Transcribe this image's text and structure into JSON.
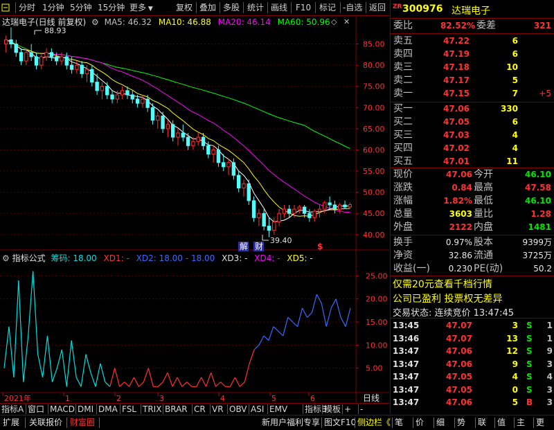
{
  "toolbar": {
    "left_items": [
      "分时",
      "1分钟",
      "5分钟",
      "15分钟",
      "更多"
    ],
    "right_items": [
      "复权",
      "叠加",
      "多股",
      "统计",
      "画线",
      "F10",
      "标记",
      "-自选",
      "返回"
    ]
  },
  "stock": {
    "name": "达瑞电子",
    "code": "300976",
    "market_tag": "ZR"
  },
  "main_chart": {
    "title": "达瑞电子(日线 前复权)",
    "ma": [
      {
        "label": "MA5: 46.32",
        "color": "#ffffff"
      },
      {
        "label": "MA10: 46.88",
        "color": "#ffff00"
      },
      {
        "label": "MA20: 46.14",
        "color": "#ff00ff"
      },
      {
        "label": "MA60: 50.96",
        "color": "#00ff00"
      }
    ],
    "high_label": "88.93",
    "low_label": "39.40",
    "marker_jie": "解",
    "marker_cai": "财",
    "marker_s": "$",
    "y_ticks": [
      "85.00",
      "80.00",
      "75.00",
      "70.00",
      "65.00",
      "60.00",
      "55.00",
      "50.00",
      "45.00",
      "40.00"
    ],
    "ma5_color": "#ffffff",
    "ma10_color": "#ffff00",
    "ma20_color": "#ff00ff",
    "ma60_color": "#00ff00",
    "up_color": "#ff3232",
    "down_color": "#54fcfc"
  },
  "chart_data": {
    "type": "candlestick",
    "y_range": [
      38,
      90
    ],
    "candles": [
      [
        85,
        87,
        83,
        86
      ],
      [
        86,
        88.93,
        84,
        85
      ],
      [
        85,
        86,
        82,
        83
      ],
      [
        83,
        84,
        80,
        81
      ],
      [
        81,
        84,
        80,
        83
      ],
      [
        83,
        85,
        81,
        82
      ],
      [
        82,
        83,
        79,
        80
      ],
      [
        80,
        83,
        79,
        82
      ],
      [
        82,
        84,
        81,
        83
      ],
      [
        83,
        84,
        81,
        82
      ],
      [
        82,
        83,
        80,
        81
      ],
      [
        81,
        83,
        80,
        82
      ],
      [
        82,
        83,
        79,
        80
      ],
      [
        80,
        82,
        78,
        79
      ],
      [
        79,
        81,
        78,
        80
      ],
      [
        80,
        81,
        77,
        78
      ],
      [
        78,
        80,
        76,
        79
      ],
      [
        79,
        80,
        75,
        76
      ],
      [
        76,
        78,
        73,
        74
      ],
      [
        74,
        76,
        72,
        75
      ],
      [
        75,
        76,
        72,
        73
      ],
      [
        73,
        74,
        71,
        72
      ],
      [
        72,
        74,
        71,
        73
      ],
      [
        73,
        75,
        72,
        74
      ],
      [
        74,
        75,
        72,
        73
      ],
      [
        73,
        74,
        71,
        72
      ],
      [
        72,
        73,
        70,
        71
      ],
      [
        71,
        73,
        70,
        72
      ],
      [
        72,
        73,
        69,
        70
      ],
      [
        70,
        71,
        66,
        67
      ],
      [
        67,
        69,
        65,
        68
      ],
      [
        68,
        69,
        64,
        65
      ],
      [
        65,
        67,
        63,
        66
      ],
      [
        66,
        67,
        62,
        63
      ],
      [
        63,
        65,
        61,
        64
      ],
      [
        64,
        66,
        62,
        63
      ],
      [
        63,
        64,
        60,
        61
      ],
      [
        61,
        63,
        60,
        62
      ],
      [
        62,
        64,
        61,
        63
      ],
      [
        63,
        64,
        60,
        61
      ],
      [
        61,
        62,
        58,
        59
      ],
      [
        59,
        61,
        57,
        60
      ],
      [
        60,
        61,
        56,
        57
      ],
      [
        57,
        59,
        55,
        56
      ],
      [
        56,
        58,
        54,
        57
      ],
      [
        57,
        58,
        53,
        54
      ],
      [
        54,
        55,
        50,
        51
      ],
      [
        51,
        53,
        49,
        52
      ],
      [
        52,
        53,
        47,
        48
      ],
      [
        48,
        49,
        43,
        44
      ],
      [
        44,
        46,
        42,
        45
      ],
      [
        45,
        46,
        41,
        42
      ],
      [
        42,
        44,
        39.4,
        41
      ],
      [
        41,
        44,
        40,
        43
      ],
      [
        43,
        46,
        42,
        45
      ],
      [
        45,
        47,
        44,
        46
      ],
      [
        46,
        47,
        44,
        45
      ],
      [
        45,
        47,
        44,
        46
      ],
      [
        46,
        47,
        45,
        46.5
      ],
      [
        46.5,
        47,
        44,
        45
      ],
      [
        45,
        46,
        43,
        44
      ],
      [
        44,
        46,
        43,
        45.5
      ],
      [
        45.5,
        47,
        44,
        46
      ],
      [
        46,
        48,
        45,
        47.5
      ],
      [
        47.5,
        49,
        46,
        47
      ],
      [
        47,
        48,
        45,
        46
      ],
      [
        46,
        47.5,
        45,
        47
      ],
      [
        47,
        48,
        46,
        46.5
      ],
      [
        46.5,
        47.58,
        46.1,
        47.06
      ]
    ],
    "ma_endpoints": {
      "ma5": 46.32,
      "ma10": 46.88,
      "ma20": 46.14,
      "ma60": 50.96
    }
  },
  "indicator": {
    "title": "指标公式",
    "code_label": "筹码:",
    "code_value": "18.00",
    "xd1": "XD1: -",
    "xd2": "XD2: 18.00",
    "xd2b": "18.00",
    "xd3": "XD3: -",
    "xd4": "XD4: -",
    "xd5": "XD5: -",
    "y_ticks": [
      "25.00",
      "20.00",
      "15.00",
      "10.00",
      "5.00"
    ],
    "y_range": [
      0,
      27
    ],
    "values": [
      5,
      14,
      3,
      24,
      2,
      12,
      26,
      8,
      3,
      12,
      2,
      5,
      9,
      1,
      11,
      3,
      1,
      8,
      4,
      1,
      6,
      2,
      1,
      5,
      1,
      2,
      1,
      3,
      1,
      2,
      5,
      1,
      1,
      2,
      4,
      1,
      3,
      1,
      2,
      1,
      1,
      3,
      1,
      4,
      1,
      2,
      1,
      1,
      3,
      1,
      2,
      6,
      9,
      10,
      12,
      11,
      14,
      13,
      12,
      16,
      15,
      14,
      18,
      16,
      17,
      21,
      19,
      14,
      18,
      20,
      16,
      14,
      18
    ],
    "date_labels": [
      "2021年",
      "1",
      "2",
      "3",
      "4",
      "5",
      "6"
    ],
    "xaxis_right_label": "日线"
  },
  "quote": {
    "wei_bi_label": "委比",
    "wei_bi_value": "82.52%",
    "wei_cha_label": "委差",
    "wei_cha_value": "321",
    "sell": [
      {
        "label": "卖五",
        "price": "47.22",
        "vol": "6",
        "chg": ""
      },
      {
        "label": "卖四",
        "price": "47.19",
        "vol": "6",
        "chg": ""
      },
      {
        "label": "卖三",
        "price": "47.18",
        "vol": "10",
        "chg": ""
      },
      {
        "label": "卖二",
        "price": "47.17",
        "vol": "5",
        "chg": ""
      },
      {
        "label": "卖一",
        "price": "47.15",
        "vol": "7",
        "chg": "+5"
      }
    ],
    "buy": [
      {
        "label": "买一",
        "price": "47.06",
        "vol": "330"
      },
      {
        "label": "买二",
        "price": "47.05",
        "vol": "6"
      },
      {
        "label": "买三",
        "price": "47.03",
        "vol": "4"
      },
      {
        "label": "买四",
        "price": "47.02",
        "vol": "4"
      },
      {
        "label": "买五",
        "price": "47.01",
        "vol": "11"
      }
    ],
    "stats": [
      {
        "l1": "现价",
        "v1": "47.06",
        "c1": "red",
        "l2": "今开",
        "v2": "46.10",
        "c2": "green"
      },
      {
        "l1": "涨跌",
        "v1": "0.84",
        "c1": "red",
        "l2": "最高",
        "v2": "47.58",
        "c2": "red"
      },
      {
        "l1": "涨幅",
        "v1": "1.82%",
        "c1": "red",
        "l2": "最低",
        "v2": "46.10",
        "c2": "green"
      },
      {
        "l1": "总量",
        "v1": "3603",
        "c1": "yellow",
        "l2": "量比",
        "v2": "1.28",
        "c2": "red"
      },
      {
        "l1": "外盘",
        "v1": "2122",
        "c1": "red",
        "l2": "内盘",
        "v2": "1481",
        "c2": "green"
      }
    ],
    "stats2": [
      {
        "l1": "换手",
        "v1": "0.97%",
        "l2": "股本",
        "v2": "9399万"
      },
      {
        "l1": "净资",
        "v1": "32.86",
        "l2": "流通",
        "v2": "3725万"
      },
      {
        "l1": "收益(一)",
        "v1": "0.230",
        "l2": "PE(动)",
        "v2": "50.2"
      }
    ],
    "promo1": "仅需20元查看千档行情",
    "promo2": "公司已盈利 投票权无差异",
    "trade_status": "交易状态: 连续竞价 13:47:45"
  },
  "trades": [
    {
      "time": "13:45",
      "price": "47.07",
      "vol": "3",
      "dir": "S",
      "n": "1"
    },
    {
      "time": "13:46",
      "price": "47.07",
      "vol": "13",
      "dir": "S",
      "n": "1"
    },
    {
      "time": "13:47",
      "price": "47.06",
      "vol": "12",
      "dir": "S",
      "n": "9"
    },
    {
      "time": "13:47",
      "price": "47.06",
      "vol": "9",
      "dir": "S",
      "n": "3"
    },
    {
      "time": "13:47",
      "price": "47.05",
      "vol": "4",
      "dir": "S",
      "n": "4"
    },
    {
      "time": "13:47",
      "price": "47.05",
      "vol": "0",
      "dir": "S",
      "n": "3"
    },
    {
      "time": "13:47",
      "price": "47.06",
      "vol": "5",
      "dir": "B",
      "n": "3"
    }
  ],
  "bottom_tabs": [
    "指标A",
    "窗口",
    "MACD",
    "DMI",
    "DMA",
    "FSL",
    "TRIX",
    "BRAR",
    "CR",
    "VR",
    "OBV",
    "ASI",
    "EMV",
    "指标B",
    "模板",
    "+",
    "-"
  ],
  "status_bar": {
    "left": [
      "扩展",
      "关联报价",
      "财富圈"
    ],
    "right": [
      "新用户福利专享",
      "图文F10",
      "侧边栏《",
      "笔",
      "价",
      "细",
      "势",
      "联",
      "值",
      "主",
      "更"
    ]
  }
}
